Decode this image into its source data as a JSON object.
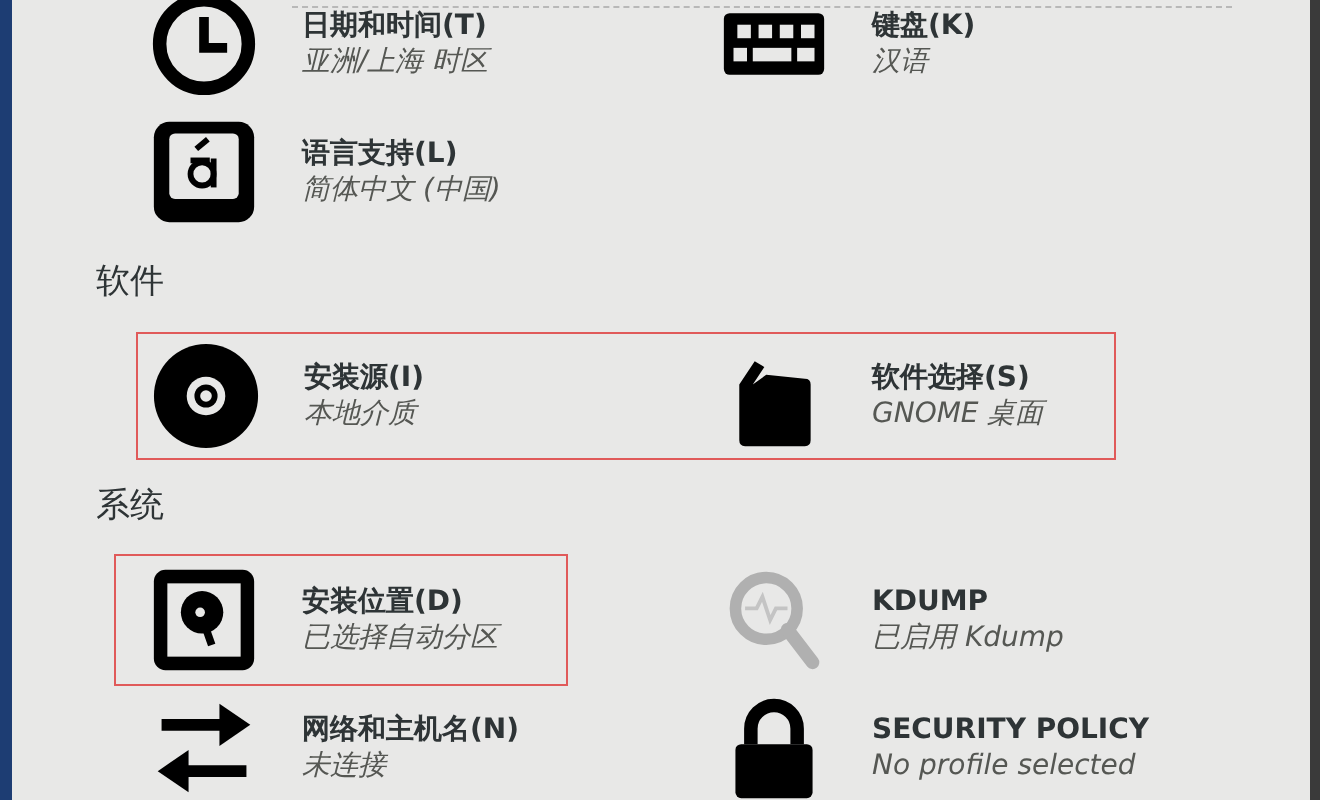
{
  "sections": [
    {
      "items": [
        {
          "kind": "clock",
          "title": "日期和时间(T)",
          "status": "亚洲/上海 时区",
          "warning": false
        },
        {
          "kind": "keyboard",
          "title": "键盘(K)",
          "status": "汉语",
          "warning": false
        },
        {
          "kind": "language",
          "title": "语言支持(L)",
          "status": "简体中文 (中国)",
          "warning": false
        }
      ]
    },
    {
      "heading": "软件",
      "items": [
        {
          "kind": "disc",
          "title": "安装源(I)",
          "status": "本地介质",
          "warning": true
        },
        {
          "kind": "package",
          "title": "软件选择(S)",
          "status": "GNOME 桌面",
          "warning": true
        }
      ]
    },
    {
      "heading": "系统",
      "items": [
        {
          "kind": "disk",
          "title": "安装位置(D)",
          "status": "已选择自动分区",
          "warning": true
        },
        {
          "kind": "magnifier",
          "title": "KDUMP",
          "status": "已启用 Kdump",
          "warning": false
        },
        {
          "kind": "arrows",
          "title": "网络和主机名(N)",
          "status": "未连接",
          "warning": false
        },
        {
          "kind": "lock",
          "title": "SECURITY POLICY",
          "status": "No profile selected",
          "warning": false
        }
      ]
    }
  ]
}
